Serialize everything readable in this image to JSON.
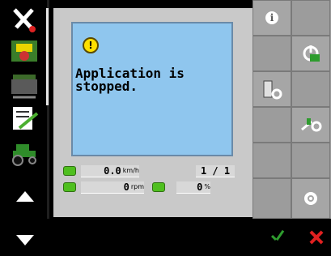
{
  "message": {
    "text": "Application is\nstopped."
  },
  "status": {
    "speed_value": "0.0",
    "speed_unit": "km/h",
    "page_counter": "1 / 1",
    "rpm_value": "0",
    "rpm_unit": "rpm",
    "percent_value": "0",
    "percent_unit": "%"
  },
  "softkeys": {
    "info_symbol": "i",
    "labels": [
      "info-icon",
      "power-on-icon",
      "machine-settings-icon",
      "hitch-lift-icon",
      "gear-settings-icon"
    ]
  },
  "colors": {
    "message_bg": "#8fc6ee",
    "panel_bg": "#c9c9c9",
    "accept": "#2e9c2e",
    "cancel": "#e02020"
  }
}
